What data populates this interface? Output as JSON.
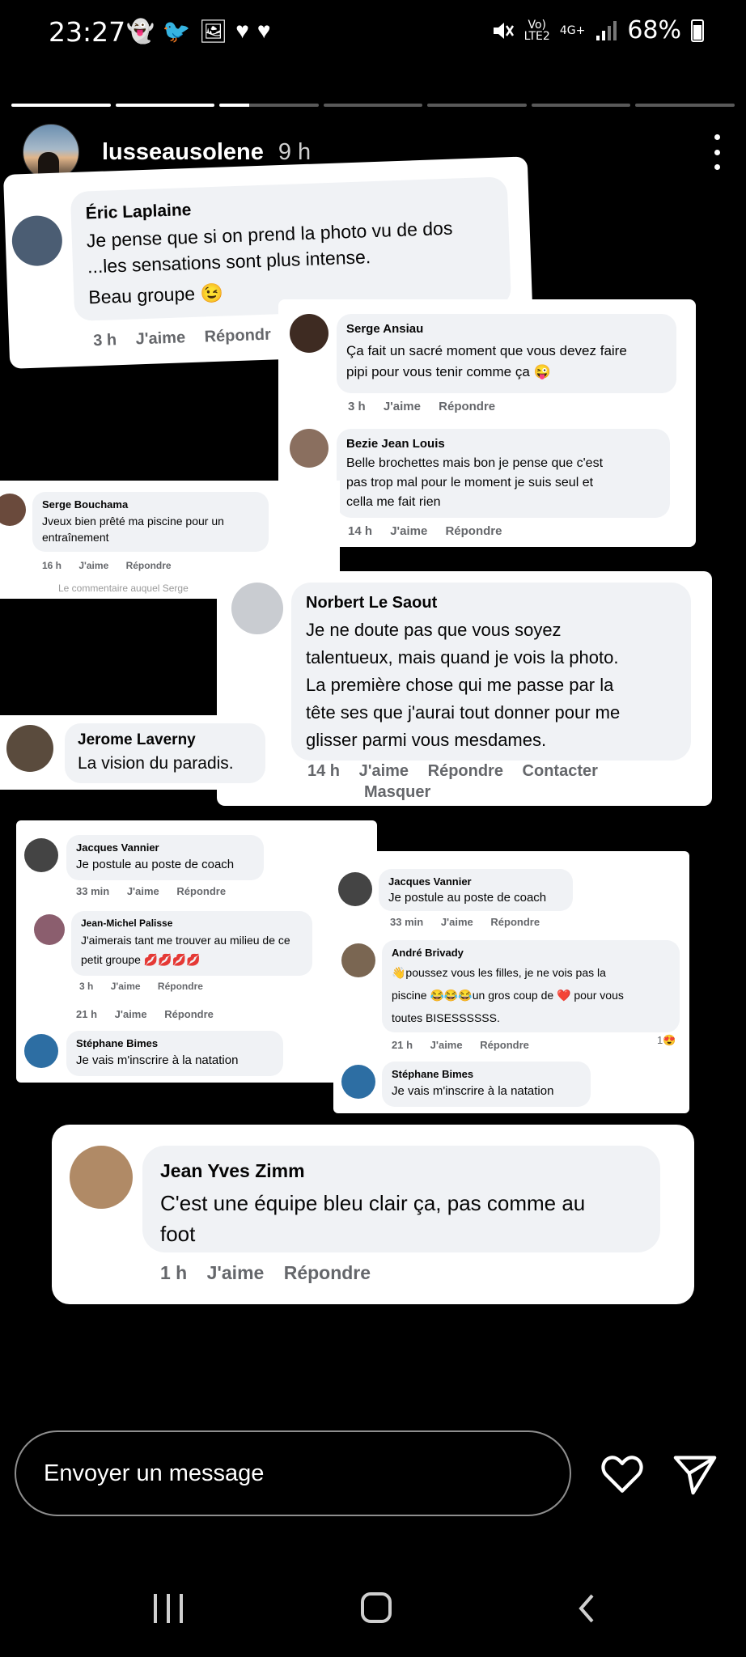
{
  "status_bar": {
    "time": "23:27",
    "carrier_top": "Vo)",
    "carrier_bottom": "LTE2",
    "network": "4G+",
    "battery": "68%"
  },
  "story": {
    "progress_segments": [
      1,
      1,
      0.3,
      0,
      0,
      0,
      0
    ],
    "username": "lusseausolene",
    "time_ago": "9 h"
  },
  "comments": {
    "eric": {
      "name": "Éric Laplaine",
      "text1": "Je pense  que si on prend  la photo  vu de dos",
      "text2": "...les sensations sont  plus  intense.",
      "text3": "Beau  groupe 😉",
      "time": "3 h",
      "like": "J'aime",
      "reply": "Répondr"
    },
    "serge_a": {
      "name": "Serge Ansiau",
      "text1": "Ça fait un sacré moment que vous devez faire",
      "text2": "pipi pour vous tenir comme ça 😜",
      "time": "3 h",
      "like": "J'aime",
      "reply": "Répondre"
    },
    "bezie": {
      "name": "Bezie Jean Louis",
      "text1": "Belle brochettes mais bon je pense que c'est",
      "text2": "pas trop mal pour le moment je suis seul et",
      "text3": "cella me fait rien",
      "time": "14 h",
      "like": "J'aime",
      "reply": "Répondre"
    },
    "serge_b": {
      "name": "Serge Bouchama",
      "text1": "Jveux bien prêté ma piscine pour un",
      "text2": "entraînement",
      "time": "16 h",
      "like": "J'aime",
      "reply": "Répondre",
      "footer": "Le commentaire auquel Serge"
    },
    "norbert": {
      "name": "Norbert Le Saout",
      "text1": "Je ne doute pas que vous soyez",
      "text2": "talentueux, mais quand je vois la photo.",
      "text3": "La première chose qui me passe par la",
      "text4": "tête ses que j'aurai tout donner pour me",
      "text5": "glisser parmi vous mesdames.",
      "time": "14 h",
      "like": "J'aime",
      "reply": "Répondre",
      "contact": "Contacter",
      "hide": "Masquer"
    },
    "jerome": {
      "name": "Jerome Laverny",
      "text1": "La vision du paradis."
    },
    "group_left": {
      "jacques": {
        "name": "Jacques Vannier",
        "text": "Je postule au poste de coach",
        "time": "33 min",
        "like": "J'aime",
        "reply": "Répondre"
      },
      "jm": {
        "name": "Jean-Michel Palisse",
        "text1": "J'aimerais tant me trouver au milieu de ce",
        "text2": "petit groupe 💋💋💋💋",
        "time": "3 h",
        "like": "J'aime",
        "reply": "Répondre"
      },
      "meta21": {
        "time": "21 h",
        "like": "J'aime",
        "reply": "Répondre"
      },
      "stephane": {
        "name": "Stéphane Bimes",
        "text": "Je vais m'inscrire à la natation"
      }
    },
    "group_right": {
      "jacques": {
        "name": "Jacques Vannier",
        "text": "Je postule au poste de coach",
        "time": "33 min",
        "like": "J'aime",
        "reply": "Répondre"
      },
      "andre": {
        "name": "André Brivady",
        "text1": "👋poussez vous les filles, je ne vois pas la",
        "text2": "piscine 😂😂😂un gros coup de ❤️ pour vous",
        "text3": "toutes BISESSSSSS.",
        "time": "21 h",
        "like": "J'aime",
        "reply": "Répondre",
        "reaction": "1😍"
      },
      "stephane": {
        "name": "Stéphane Bimes",
        "text": "Je vais m'inscrire à la natation"
      }
    },
    "jean_yves": {
      "name": "Jean Yves Zimm",
      "text1": "C'est une équipe bleu clair ça, pas comme au",
      "text2": "foot",
      "time": "1 h",
      "like": "J'aime",
      "reply": "Répondre"
    }
  },
  "message_bar": {
    "placeholder": "Envoyer un message"
  },
  "icons": {
    "mute": "mute-icon",
    "signal": "signal-icon",
    "heart": "heart-icon",
    "send": "send-icon",
    "more": "more-icon"
  }
}
